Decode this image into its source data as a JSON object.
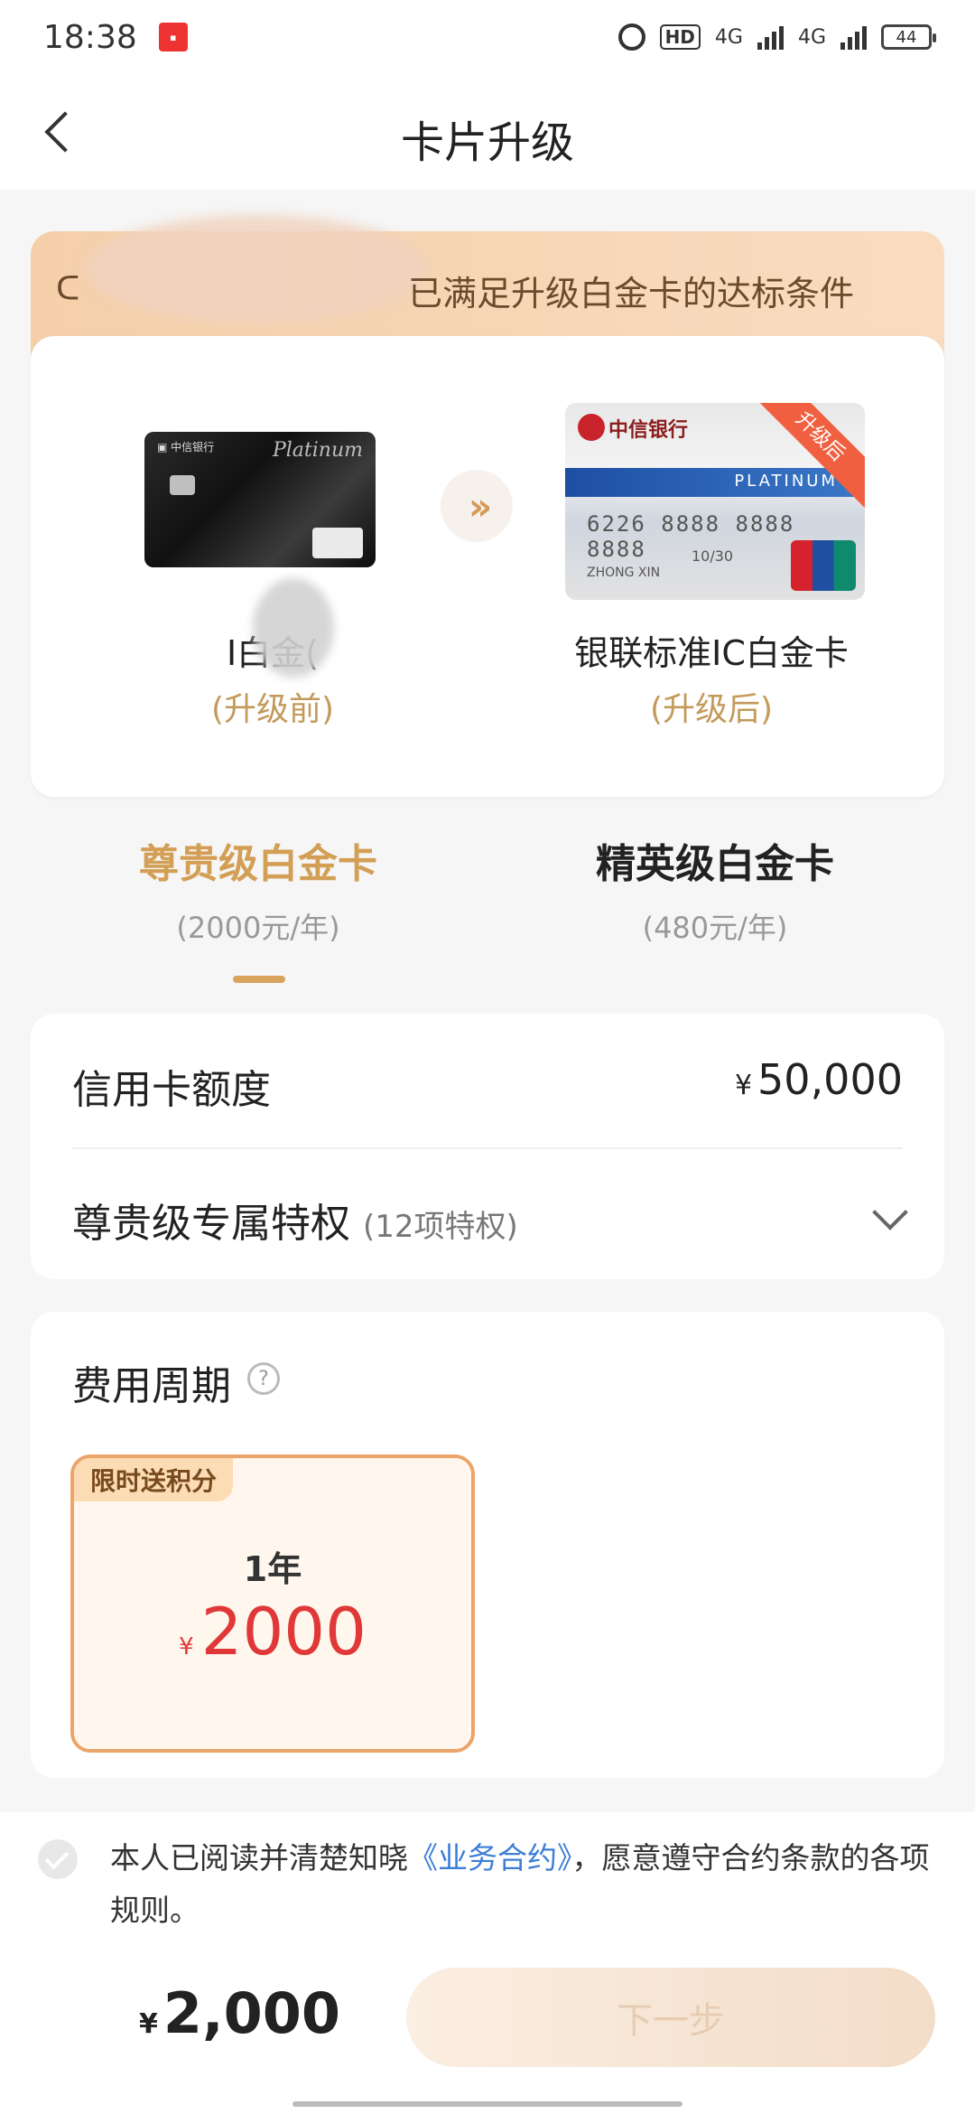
{
  "status_bar": {
    "time": "18:38",
    "hd": "HD",
    "net1": "4G",
    "net2": "4G",
    "battery": "44"
  },
  "header": {
    "title": "卡片升级"
  },
  "banner": {
    "text": "已满足升级白金卡的达标条件"
  },
  "upgrade": {
    "old_card": {
      "name": "I白金(",
      "sub": "(升级前)",
      "platinum_label": "Platinum"
    },
    "new_card": {
      "name": "银联标准IC白金卡",
      "sub": "(升级后)",
      "ribbon": "升级后",
      "bank_name": "中信银行",
      "stripe_label": "PLATINUM",
      "number": "6226 8888 8888 8888",
      "expiry": "10/30",
      "holder": "ZHONG XIN"
    }
  },
  "tabs": [
    {
      "title": "尊贵级白金卡",
      "fee": "(2000元/年)"
    },
    {
      "title": "精英级白金卡",
      "fee": "(480元/年)"
    }
  ],
  "limit": {
    "label": "信用卡额度",
    "currency": "¥",
    "value": "50,000",
    "privilege_label": "尊贵级专属特权",
    "privilege_count": "(12项特权)"
  },
  "fee": {
    "label": "费用周期",
    "help_symbol": "?",
    "option": {
      "tag": "限时送积分",
      "period": "1年",
      "currency": "¥",
      "price": "2000"
    }
  },
  "agreement": {
    "prefix": "本人已阅读并清楚知晓",
    "link": "《业务合约》",
    "suffix": "，愿意遵守合约条款的各项规则。"
  },
  "footer": {
    "currency": "¥",
    "total": "2,000",
    "next_label": "下一步"
  },
  "colors": {
    "accent_gold": "#d39f55",
    "price_red": "#e03838",
    "link_blue": "#3b7dd8"
  }
}
